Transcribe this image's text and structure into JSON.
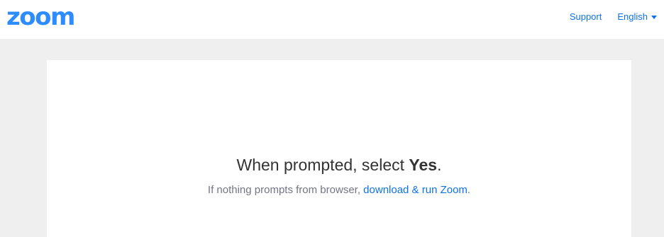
{
  "colors": {
    "brand": "#2d8cff",
    "link": "#0e72ed",
    "page_bg": "#efefef",
    "text_dark": "#333333",
    "text_muted": "#747487"
  },
  "header": {
    "logo_text": "zoom",
    "nav": {
      "support_label": "Support",
      "language_label": "English",
      "language_icon": "caret-down-icon"
    }
  },
  "main": {
    "headline_prefix": "When prompted, select ",
    "headline_emphasis": "Yes",
    "headline_suffix": ".",
    "subline_prefix": "If nothing prompts from browser, ",
    "subline_link": "download & run Zoom",
    "subline_suffix": "."
  }
}
